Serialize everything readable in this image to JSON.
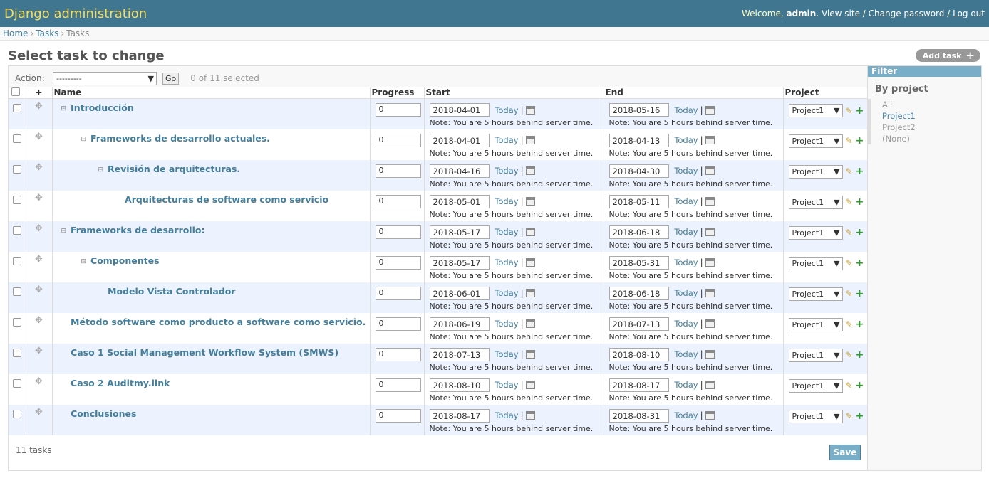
{
  "header": {
    "brand": "Django administration",
    "welcome": "Welcome,",
    "username": "admin",
    "view_site": "View site",
    "change_password": "Change password",
    "log_out": "Log out",
    "separator": "/"
  },
  "breadcrumbs": [
    "Home",
    "Tasks",
    "Tasks"
  ],
  "page": {
    "title": "Select task to change",
    "add_button": "Add task"
  },
  "actions": {
    "label": "Action:",
    "select_value": "---------",
    "go": "Go",
    "counter": "0 of 11 selected"
  },
  "table": {
    "headers": {
      "drag": "+",
      "name": "Name",
      "progress": "Progress",
      "start": "Start",
      "end": "End",
      "project": "Project"
    },
    "today_label": "Today",
    "pipe": "|",
    "tz_note": "Note: You are 5 hours behind server time.",
    "rows": [
      {
        "name": "Introducción",
        "level": 0,
        "toggle": true,
        "progress": "0",
        "start": "2018-04-01",
        "end": "2018-05-16",
        "project": "Project1"
      },
      {
        "name": "Frameworks de desarrollo actuales.",
        "level": 1,
        "toggle": true,
        "progress": "0",
        "start": "2018-04-01",
        "end": "2018-04-13",
        "project": "Project1"
      },
      {
        "name": "Revisión de arquitecturas.",
        "level": 2,
        "toggle": true,
        "progress": "0",
        "start": "2018-04-16",
        "end": "2018-04-30",
        "project": "Project1"
      },
      {
        "name": "Arquitecturas de software como servicio",
        "level": 3,
        "toggle": false,
        "progress": "0",
        "start": "2018-05-01",
        "end": "2018-05-11",
        "project": "Project1"
      },
      {
        "name": "Frameworks de desarrollo:",
        "level": 0,
        "toggle": true,
        "progress": "0",
        "start": "2018-05-17",
        "end": "2018-06-18",
        "project": "Project1"
      },
      {
        "name": "Componentes",
        "level": 1,
        "toggle": true,
        "progress": "0",
        "start": "2018-05-17",
        "end": "2018-05-31",
        "project": "Project1"
      },
      {
        "name": "Modelo Vista Controlador",
        "level": 2,
        "toggle": false,
        "progress": "0",
        "start": "2018-06-01",
        "end": "2018-06-18",
        "project": "Project1"
      },
      {
        "name": "Método software como producto a software como servicio.",
        "level": 0,
        "toggle": false,
        "progress": "0",
        "start": "2018-06-19",
        "end": "2018-07-13",
        "project": "Project1"
      },
      {
        "name": "Caso 1 Social Management Workflow System (SMWS)",
        "level": 0,
        "toggle": false,
        "progress": "0",
        "start": "2018-07-13",
        "end": "2018-08-10",
        "project": "Project1"
      },
      {
        "name": "Caso 2 Auditmy.link",
        "level": 0,
        "toggle": false,
        "progress": "0",
        "start": "2018-08-10",
        "end": "2018-08-17",
        "project": "Project1"
      },
      {
        "name": "Conclusiones",
        "level": 0,
        "toggle": false,
        "progress": "0",
        "start": "2018-08-17",
        "end": "2018-08-31",
        "project": "Project1"
      }
    ]
  },
  "footer": {
    "count": "11 tasks",
    "save": "Save"
  },
  "filter": {
    "title": "Filter",
    "group_title": "By project",
    "options": [
      {
        "label": "All",
        "selected": false
      },
      {
        "label": "Project1",
        "selected": true
      },
      {
        "label": "Project2",
        "selected": false
      },
      {
        "label": "(None)",
        "selected": false
      }
    ]
  },
  "colors": {
    "header_bg": "#417690",
    "brand": "#f5dd5d",
    "link": "#447e9b",
    "row_alt": "#edf3fe",
    "filter_header": "#79aec8"
  },
  "icons": {
    "drag": "move-icon",
    "toggle": "collapse-icon",
    "calendar": "calendar-icon",
    "edit": "pencil-icon",
    "add": "plus-icon",
    "dropdown": "chevron-down-icon"
  }
}
